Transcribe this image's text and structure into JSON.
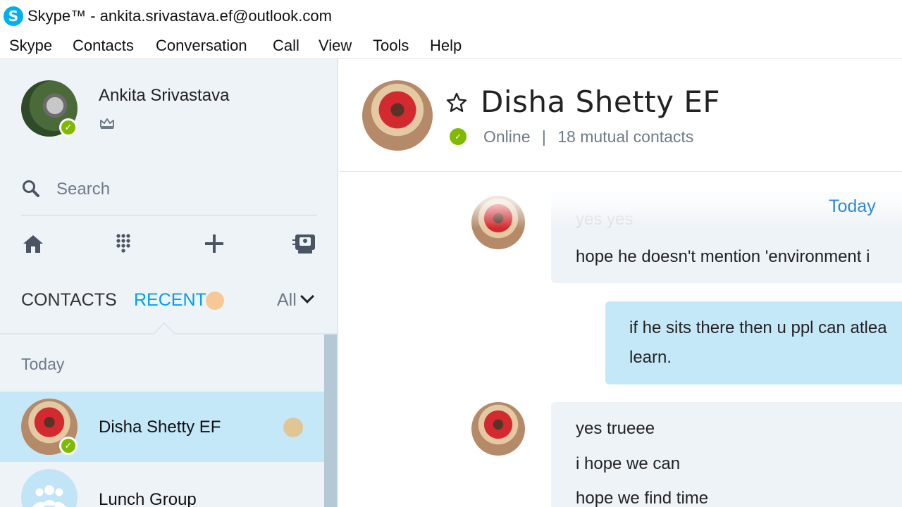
{
  "window": {
    "title": "Skype™ - ankita.srivastava.ef@outlook.com",
    "logo_letter": "S"
  },
  "menu": [
    "Skype",
    "Contacts",
    "Conversation",
    "Call",
    "View",
    "Tools",
    "Help"
  ],
  "profile": {
    "name": "Ankita Srivastava",
    "presence": "online"
  },
  "search": {
    "placeholder": "Search"
  },
  "toolbar": {
    "icons": [
      "home-icon",
      "dialpad-icon",
      "add-icon",
      "contact-card-icon"
    ]
  },
  "tabs": {
    "contacts": "CONTACTS",
    "recent": "RECENT",
    "filter": "All"
  },
  "recent_list": {
    "section_label": "Today",
    "items": [
      {
        "name": "Disha Shetty EF",
        "presence": "online",
        "selected": true,
        "unread": true
      },
      {
        "name": "Lunch Group",
        "presence": "",
        "selected": false,
        "unread": false
      }
    ]
  },
  "conversation": {
    "name": "Disha Shetty EF",
    "status": "Online",
    "separator": "|",
    "mutual": "18 mutual contacts",
    "date_label": "Today",
    "messages": [
      {
        "from": "them",
        "lines": [
          "yes yes",
          "hope he doesn't mention 'environment i"
        ]
      },
      {
        "from": "me",
        "lines": [
          "if he sits there then u ppl can atlea",
          "learn."
        ]
      },
      {
        "from": "them",
        "lines": [
          "yes trueee",
          "i hope we can",
          "hope we find time"
        ]
      }
    ]
  },
  "colors": {
    "skype_blue": "#00aff0",
    "presence_green": "#7fba00",
    "accent_blue": "#00a2e8",
    "selected_bg": "#c5e8f9",
    "pane_bg": "#eef3f8"
  }
}
